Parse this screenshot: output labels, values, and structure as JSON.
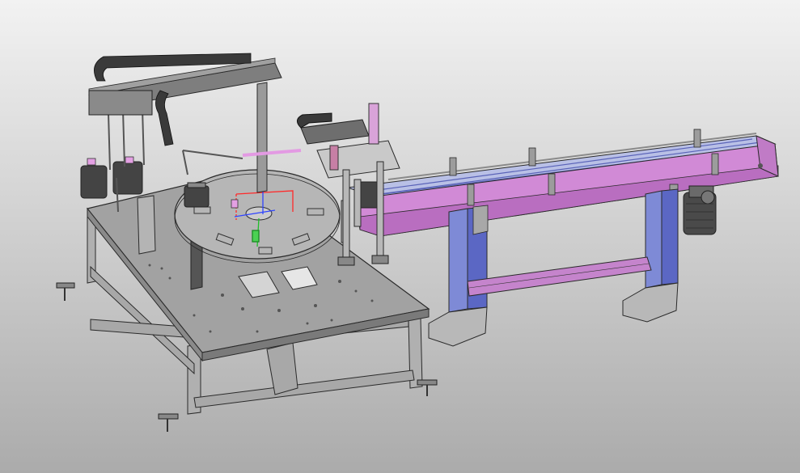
{
  "viewport": {
    "background_top": "#f2f2f2",
    "background_bottom": "#ababab",
    "render_mode": "shaded-with-edges"
  },
  "colors": {
    "steel": "#9c9c9c",
    "steel_light": "#c8c8c8",
    "steel_dark": "#6e6e6e",
    "conveyor_magenta": "#d18ad6",
    "conveyor_magenta_dark": "#a85fb0",
    "conveyor_blue": "#6d7bd6",
    "sketch_red": "#ff2a2a",
    "sketch_blue": "#2f44ff",
    "sketch_green": "#1fbf2a",
    "motor_dark": "#444444"
  },
  "model": {
    "components": [
      "frame-table",
      "rotary-index-table",
      "linear-gantry-with-cable-chain",
      "vertical-column-gantry",
      "belt-conveyor",
      "conveyor-support-legs",
      "drive-motor"
    ]
  }
}
